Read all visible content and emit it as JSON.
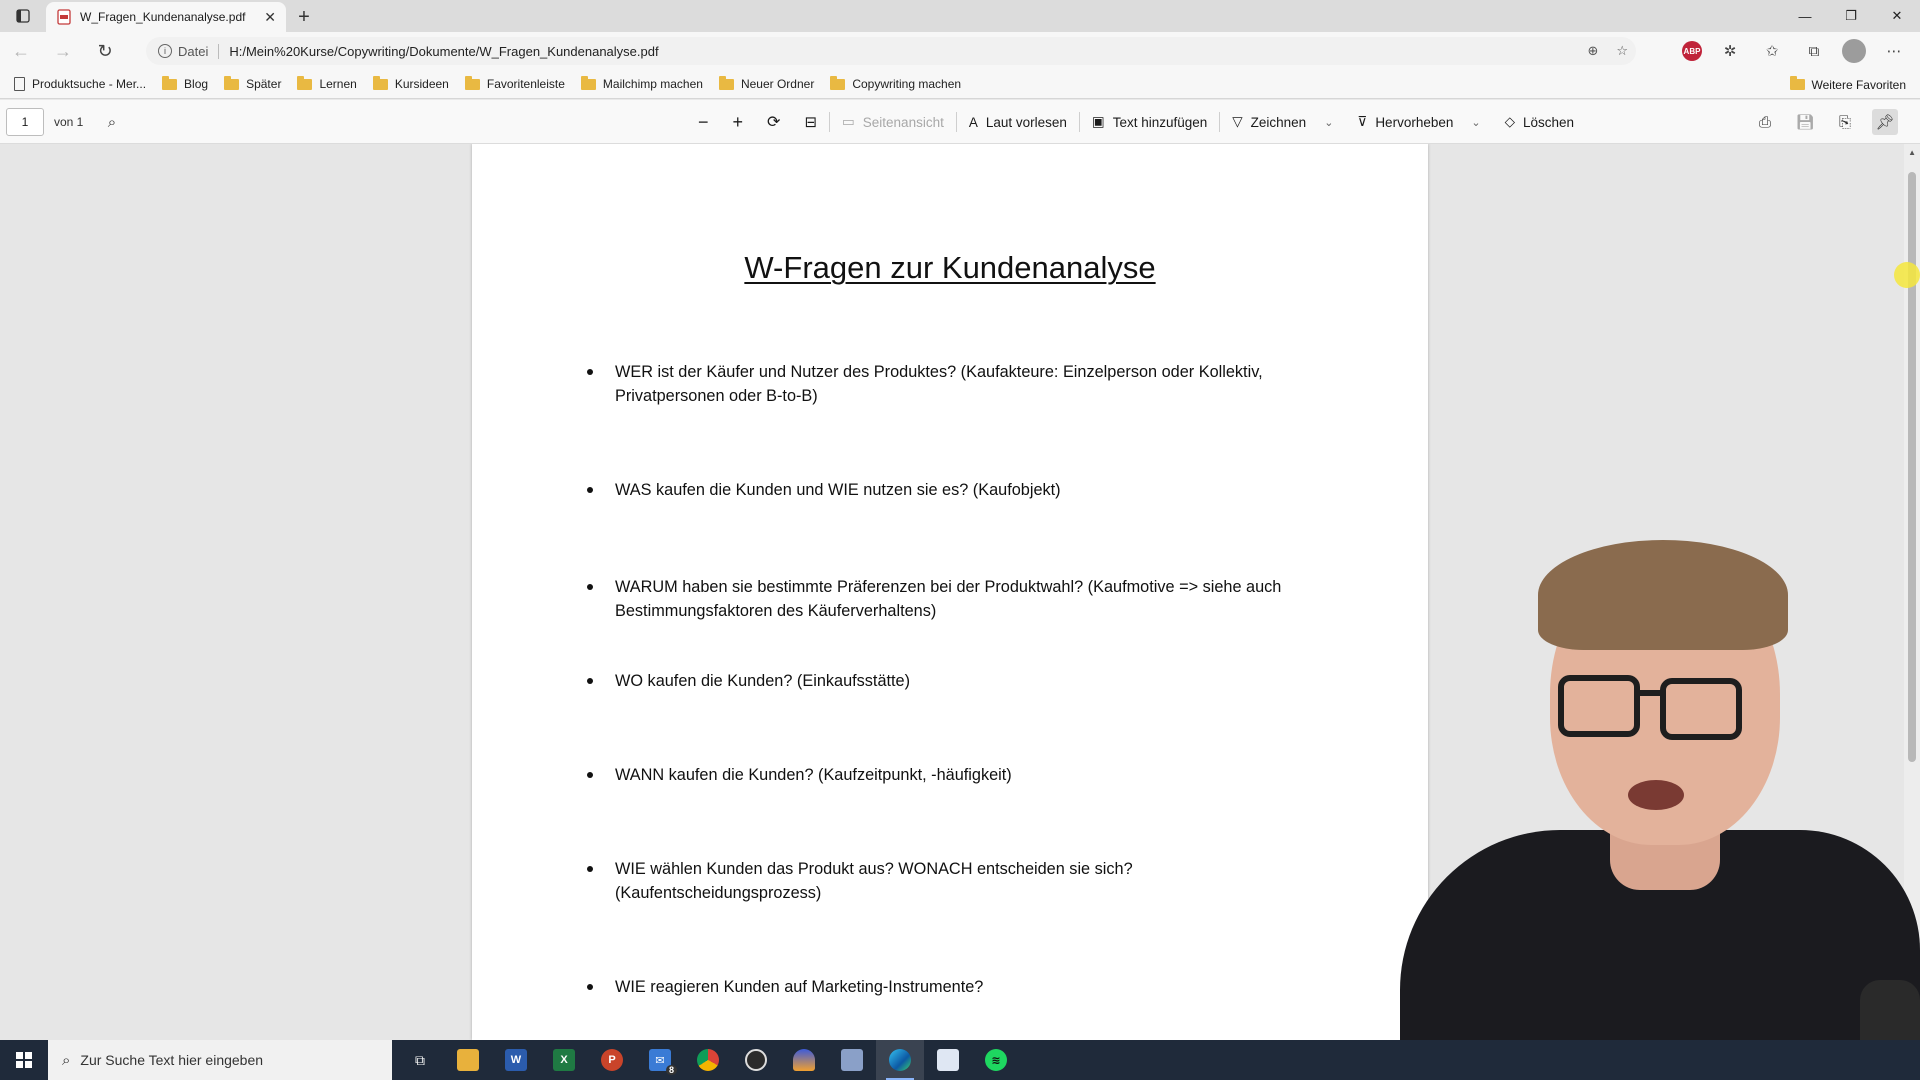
{
  "browser": {
    "tab_title": "W_Fragen_Kundenanalyse.pdf",
    "address_info": "Datei",
    "url": "H:/Mein%20Kurse/Copywriting/Dokumente/W_Fragen_Kundenanalyse.pdf"
  },
  "bookmarks": {
    "items": [
      {
        "label": "Produktsuche - Mer...",
        "icon": "page-icon"
      },
      {
        "label": "Blog",
        "icon": "folder-icon"
      },
      {
        "label": "Später",
        "icon": "folder-icon"
      },
      {
        "label": "Lernen",
        "icon": "folder-icon"
      },
      {
        "label": "Kursideen",
        "icon": "folder-icon"
      },
      {
        "label": "Favoritenleiste",
        "icon": "folder-icon"
      },
      {
        "label": "Mailchimp machen",
        "icon": "folder-icon"
      },
      {
        "label": "Neuer Ordner",
        "icon": "folder-icon"
      },
      {
        "label": "Copywriting machen",
        "icon": "folder-icon"
      }
    ],
    "other_favorites": "Weitere Favoriten"
  },
  "pdf_toolbar": {
    "page_current": "1",
    "page_of": "von 1",
    "page_view": "Seitenansicht",
    "read_aloud": "Laut vorlesen",
    "add_text": "Text hinzufügen",
    "draw": "Zeichnen",
    "highlight": "Hervorheben",
    "erase": "Löschen"
  },
  "document": {
    "title": "W-Fragen zur Kundenanalyse",
    "bullets": [
      "WER ist der Käufer und Nutzer des Produktes? (Kaufakteure: Einzelperson oder Kollektiv, Privatpersonen oder B-to-B)",
      "WAS kaufen die Kunden und WIE nutzen sie es? (Kaufobjekt)",
      "WARUM haben sie bestimmte Präferenzen bei der Produktwahl? (Kaufmotive => siehe auch Bestimmungsfaktoren des Käuferverhaltens)",
      "WO kaufen die Kunden? (Einkaufsstätte)",
      "WANN kaufen die Kunden? (Kaufzeitpunkt, -häufigkeit)",
      "WIE wählen Kunden das Produkt aus? WONACH entscheiden sie sich? (Kaufentscheidungsprozess)",
      "WIE reagieren Kunden auf Marketing-Instrumente?"
    ]
  },
  "taskbar": {
    "search_placeholder": "Zur Suche Text hier eingeben",
    "mail_badge": "8"
  },
  "colors": {
    "taskbar_bg": "#1f2a3a",
    "cursor_highlight": "#f5e63c",
    "abp_red": "#c0233a"
  }
}
